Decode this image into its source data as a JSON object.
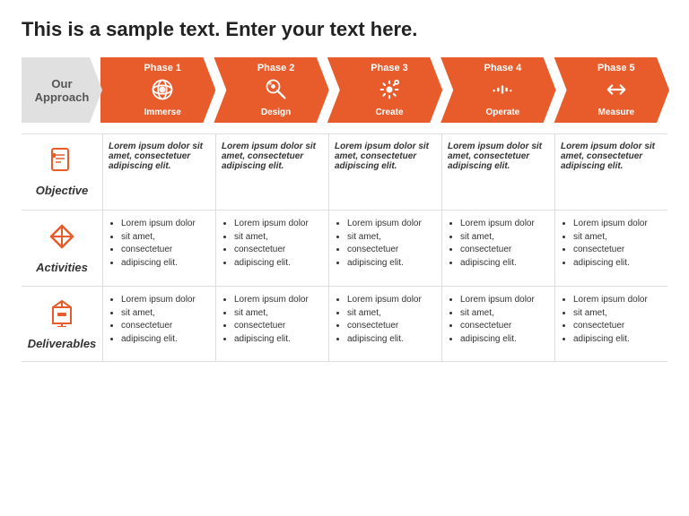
{
  "title": "This is a sample text. Enter your text here.",
  "our_approach": "Our\nApproach",
  "phases": [
    {
      "id": "phase1",
      "label": "Phase 1",
      "name": "Immerse",
      "icon": "🌐"
    },
    {
      "id": "phase2",
      "label": "Phase 2",
      "name": "Design",
      "icon": "🎨"
    },
    {
      "id": "phase3",
      "label": "Phase 3",
      "name": "Create",
      "icon": "⚙"
    },
    {
      "id": "phase4",
      "label": "Phase 4",
      "name": "Operate",
      "icon": "📶"
    },
    {
      "id": "phase5",
      "label": "Phase 5",
      "name": "Measure",
      "icon": "↔"
    }
  ],
  "rows": [
    {
      "id": "objective",
      "label": "Objective",
      "type": "bold",
      "cells": [
        "Lorem ipsum dolor sit amet, consectetuer adipiscing elit.",
        "Lorem ipsum dolor sit amet, consectetuer adipiscing elit.",
        "Lorem ipsum dolor sit amet, consectetuer adipiscing elit.",
        "Lorem ipsum dolor sit amet, consectetuer adipiscing elit.",
        "Lorem ipsum dolor sit amet, consectetuer adipiscing elit."
      ]
    },
    {
      "id": "activities",
      "label": "Activities",
      "type": "list",
      "cells": [
        [
          "Lorem ipsum dolor",
          "sit amet,",
          "consectetuer",
          "adipiscing elit."
        ],
        [
          "Lorem ipsum dolor",
          "sit amet,",
          "consectetuer",
          "adipiscing elit."
        ],
        [
          "Lorem ipsum dolor",
          "sit amet,",
          "consectetuer",
          "adipiscing elit."
        ],
        [
          "Lorem ipsum dolor",
          "sit amet,",
          "consectetuer",
          "adipiscing elit."
        ],
        [
          "Lorem ipsum dolor",
          "sit amet,",
          "consectetuer",
          "adipiscing elit."
        ]
      ]
    },
    {
      "id": "deliverables",
      "label": "Deliverables",
      "type": "list",
      "cells": [
        [
          "Lorem ipsum dolor",
          "sit amet,",
          "consectetuer",
          "adipiscing elit."
        ],
        [
          "Lorem ipsum dolor",
          "sit amet,",
          "consectetuer",
          "adipiscing elit."
        ],
        [
          "Lorem ipsum dolor",
          "sit amet,",
          "consectetuer",
          "adipiscing elit."
        ],
        [
          "Lorem ipsum dolor",
          "sit amet,",
          "consectetuer",
          "adipiscing elit."
        ],
        [
          "Lorem ipsum dolor",
          "sit amet,",
          "consectetuer",
          "adipiscing elit."
        ]
      ]
    }
  ],
  "accent_color": "#e85c2c"
}
